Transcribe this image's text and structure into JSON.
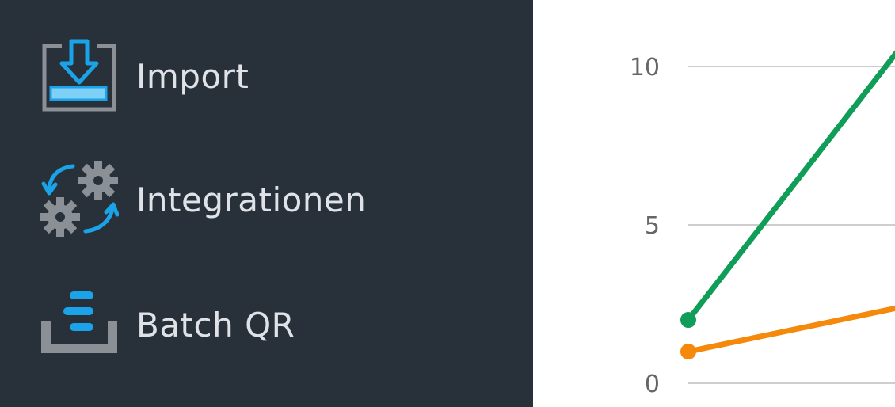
{
  "sidebar": {
    "items": [
      {
        "label": "Import",
        "icon": "import-icon"
      },
      {
        "label": "Integrationen",
        "icon": "integrations-gear-icon"
      },
      {
        "label": "Batch QR",
        "icon": "batch-qr-icon"
      }
    ]
  },
  "colors": {
    "sidebar_bg": "#28313a",
    "accent_blue": "#1aa3e8",
    "icon_gray": "#8a9096",
    "series_green": "#0f9d58",
    "series_orange": "#f4890b",
    "grid": "#bdbdbd"
  },
  "chart_data": {
    "type": "line",
    "x": [
      0,
      1
    ],
    "ylim": [
      0,
      10
    ],
    "y_ticks": [
      0,
      5,
      10
    ],
    "y_tick_labels": [
      "0",
      "5",
      "10"
    ],
    "grid": true,
    "series": [
      {
        "values": [
          2,
          10.6
        ],
        "color": "#0f9d58"
      },
      {
        "values": [
          1,
          2.4
        ],
        "color": "#f4890b"
      }
    ]
  }
}
